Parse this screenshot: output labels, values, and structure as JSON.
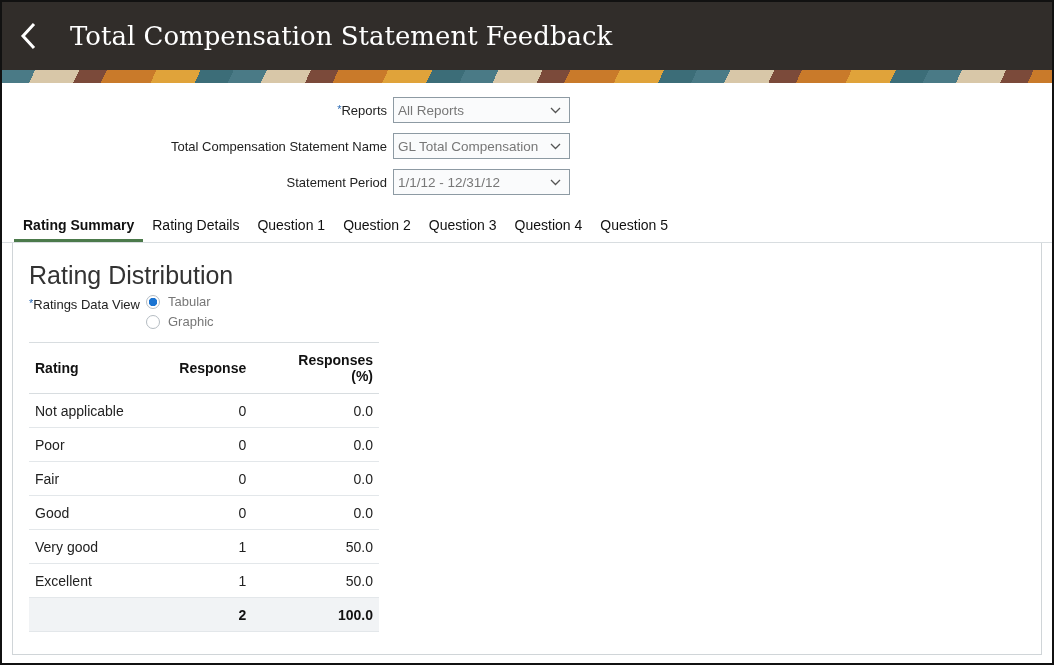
{
  "header": {
    "title": "Total Compensation Statement Feedback"
  },
  "filters": [
    {
      "required_mark": "*",
      "label": "Reports",
      "value": "All Reports"
    },
    {
      "label": "Total Compensation Statement Name",
      "value": "GL Total Compensation"
    },
    {
      "label": "Statement Period",
      "value": "1/1/12 - 12/31/12"
    }
  ],
  "tabs": [
    {
      "label": "Rating Summary",
      "selected": true
    },
    {
      "label": "Rating Details",
      "selected": false
    },
    {
      "label": "Question 1",
      "selected": false
    },
    {
      "label": "Question 2",
      "selected": false
    },
    {
      "label": "Question 3",
      "selected": false
    },
    {
      "label": "Question 4",
      "selected": false
    },
    {
      "label": "Question 5",
      "selected": false
    }
  ],
  "section": {
    "title": "Rating Distribution",
    "data_view": {
      "required_mark": "*",
      "label": "Ratings Data View",
      "options": [
        {
          "label": "Tabular",
          "selected": true
        },
        {
          "label": "Graphic",
          "selected": false
        }
      ]
    },
    "table": {
      "columns": [
        "Rating",
        "Response",
        "Responses (%)"
      ],
      "rows": [
        [
          "Not applicable",
          "0",
          "0.0"
        ],
        [
          "Poor",
          "0",
          "0.0"
        ],
        [
          "Fair",
          "0",
          "0.0"
        ],
        [
          "Good",
          "0",
          "0.0"
        ],
        [
          "Very good",
          "1",
          "50.0"
        ],
        [
          "Excellent",
          "1",
          "50.0"
        ]
      ],
      "total": {
        "response": "2",
        "percent": "100.0"
      }
    }
  }
}
